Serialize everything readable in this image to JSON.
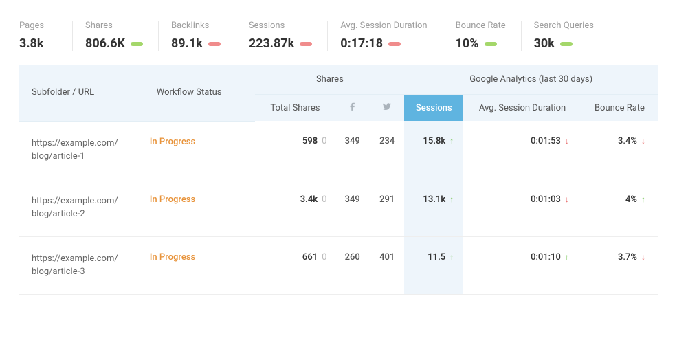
{
  "stats": [
    {
      "label": "Pages",
      "value": "3.8k",
      "pill": null
    },
    {
      "label": "Shares",
      "value": "806.6K",
      "pill": "green"
    },
    {
      "label": "Backlinks",
      "value": "89.1k",
      "pill": "red"
    },
    {
      "label": "Sessions",
      "value": "223.87k",
      "pill": "red"
    },
    {
      "label": "Avg. Session Duration",
      "value": "0:17:18",
      "pill": "red"
    },
    {
      "label": "Bounce Rate",
      "value": "10%",
      "pill": "green"
    },
    {
      "label": "Search Queries",
      "value": "30k",
      "pill": "green"
    }
  ],
  "table": {
    "headers": {
      "subfolder": "Subfolder / URL",
      "workflow": "Workflow Status",
      "shares_group": "Shares",
      "ga_group": "Google Analytics (last 30 days)",
      "total_shares": "Total Shares",
      "sessions": "Sessions",
      "duration": "Avg. Session Duration",
      "bounce": "Bounce Rate"
    },
    "rows": [
      {
        "url_line1": "https://example.com/",
        "url_line2": "blog/article-1",
        "status": "In Progress",
        "total_shares": "598",
        "total_shares_delta": "0",
        "fb": "349",
        "tw": "234",
        "sessions": "15.8k",
        "sessions_trend": "up",
        "duration": "0:01:53",
        "duration_trend": "down",
        "bounce": "3.4%",
        "bounce_trend": "down"
      },
      {
        "url_line1": "https://example.com/",
        "url_line2": "blog/article-2",
        "status": "In Progress",
        "total_shares": "3.4k",
        "total_shares_delta": "0",
        "fb": "349",
        "tw": "291",
        "sessions": "13.1k",
        "sessions_trend": "up",
        "duration": "0:01:03",
        "duration_trend": "down",
        "bounce": "4%",
        "bounce_trend": "up"
      },
      {
        "url_line1": "https://example.com/",
        "url_line2": "blog/article-3",
        "status": "In Progress",
        "total_shares": "661",
        "total_shares_delta": "0",
        "fb": "260",
        "tw": "401",
        "sessions": "11.5",
        "sessions_trend": "up",
        "duration": "0:01:10",
        "duration_trend": "up",
        "bounce": "3.7%",
        "bounce_trend": "down"
      }
    ]
  }
}
